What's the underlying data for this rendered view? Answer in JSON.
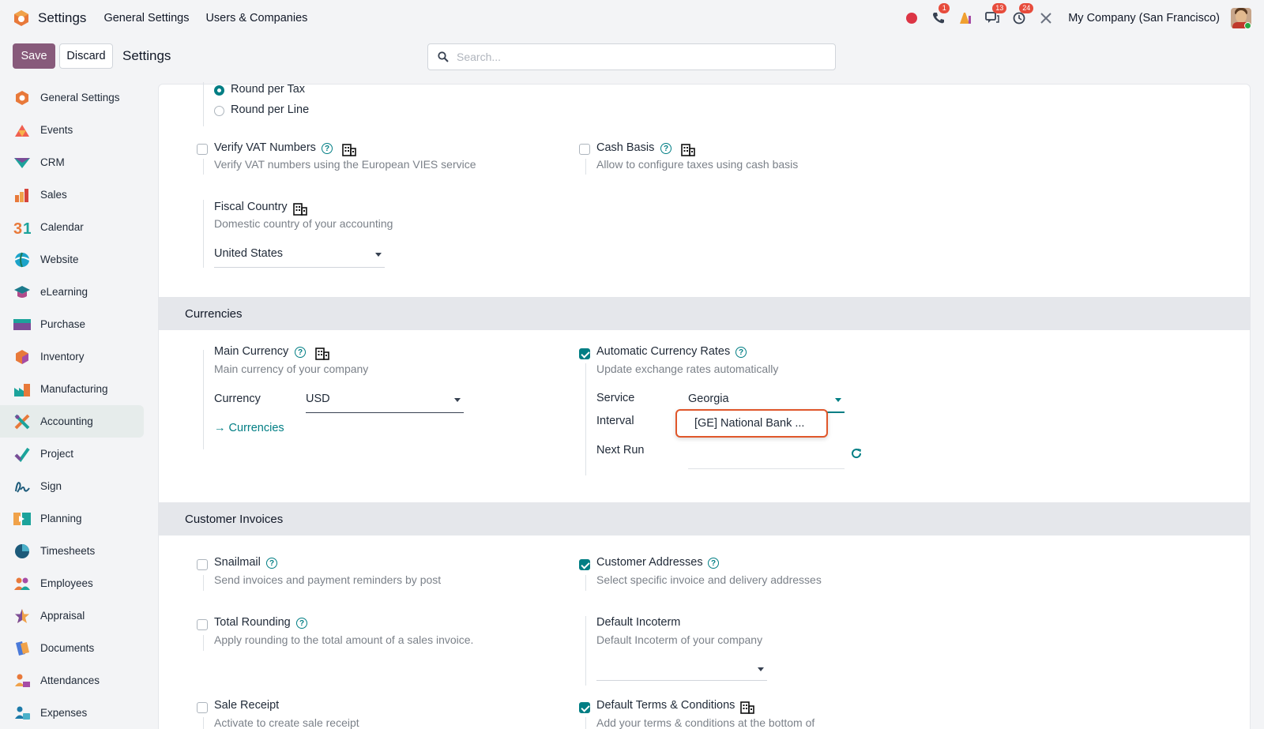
{
  "navbar": {
    "app_name": "Settings",
    "menus": [
      "General Settings",
      "Users & Companies"
    ],
    "badges": {
      "phone": "1",
      "messages": "13",
      "activities": "24"
    },
    "company": "My Company (San Francisco)"
  },
  "control_panel": {
    "save_label": "Save",
    "discard_label": "Discard",
    "title": "Settings",
    "search_placeholder": "Search..."
  },
  "sidebar": {
    "items": [
      {
        "label": "General Settings",
        "icon": "general-settings-icon"
      },
      {
        "label": "Events",
        "icon": "events-icon"
      },
      {
        "label": "CRM",
        "icon": "crm-icon"
      },
      {
        "label": "Sales",
        "icon": "sales-icon"
      },
      {
        "label": "Calendar",
        "icon": "calendar-icon"
      },
      {
        "label": "Website",
        "icon": "website-icon"
      },
      {
        "label": "eLearning",
        "icon": "elearning-icon"
      },
      {
        "label": "Purchase",
        "icon": "purchase-icon"
      },
      {
        "label": "Inventory",
        "icon": "inventory-icon"
      },
      {
        "label": "Manufacturing",
        "icon": "manufacturing-icon"
      },
      {
        "label": "Accounting",
        "icon": "accounting-icon"
      },
      {
        "label": "Project",
        "icon": "project-icon"
      },
      {
        "label": "Sign",
        "icon": "sign-icon"
      },
      {
        "label": "Planning",
        "icon": "planning-icon"
      },
      {
        "label": "Timesheets",
        "icon": "timesheets-icon"
      },
      {
        "label": "Employees",
        "icon": "employees-icon"
      },
      {
        "label": "Appraisal",
        "icon": "appraisal-icon"
      },
      {
        "label": "Documents",
        "icon": "documents-icon"
      },
      {
        "label": "Attendances",
        "icon": "attendances-icon"
      },
      {
        "label": "Expenses",
        "icon": "expenses-icon"
      }
    ],
    "active": "Accounting"
  },
  "taxes": {
    "round_per_tax": "Round per Tax",
    "round_per_line": "Round per Line",
    "verify_vat": {
      "label": "Verify VAT Numbers",
      "desc": "Verify VAT numbers using the European VIES service",
      "checked": false
    },
    "cash_basis": {
      "label": "Cash Basis",
      "desc": "Allow to configure taxes using cash basis",
      "checked": false
    },
    "fiscal_country": {
      "label": "Fiscal Country",
      "desc": "Domestic country of your accounting",
      "value": "United States"
    }
  },
  "currencies": {
    "header": "Currencies",
    "main_currency": {
      "label": "Main Currency",
      "desc": "Main currency of your company",
      "currency_label": "Currency",
      "value": "USD",
      "link": "Currencies"
    },
    "auto_rates": {
      "label": "Automatic Currency Rates",
      "desc": "Update exchange rates automatically",
      "checked": true,
      "service_label": "Service",
      "service_value": "Georgia",
      "interval_label": "Interval",
      "next_run_label": "Next Run",
      "dropdown_option": "[GE] National Bank ..."
    }
  },
  "customer_invoices": {
    "header": "Customer Invoices",
    "snailmail": {
      "label": "Snailmail",
      "desc": "Send invoices and payment reminders by post",
      "checked": false
    },
    "customer_addresses": {
      "label": "Customer Addresses",
      "desc": "Select specific invoice and delivery addresses",
      "checked": true
    },
    "total_rounding": {
      "label": "Total Rounding",
      "desc": "Apply rounding to the total amount of a sales invoice.",
      "checked": false
    },
    "default_incoterm": {
      "label": "Default Incoterm",
      "desc": "Default Incoterm of your company"
    },
    "sale_receipt": {
      "label": "Sale Receipt",
      "desc": "Activate to create sale receipt",
      "checked": false
    },
    "default_terms": {
      "label": "Default Terms & Conditions",
      "desc": "Add your terms & conditions at the bottom of",
      "checked": true
    }
  },
  "colors": {
    "primary": "#875a7b",
    "accent": "#017e84",
    "highlight": "#e0572b"
  }
}
